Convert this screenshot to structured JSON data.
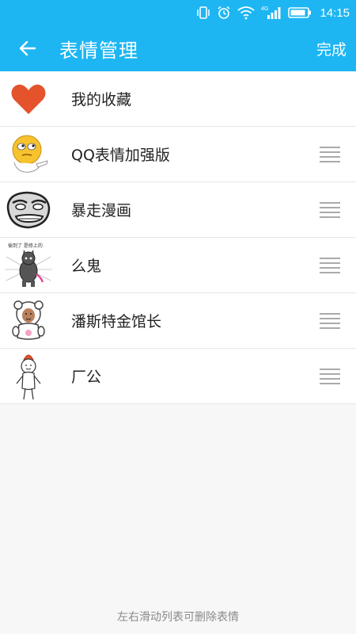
{
  "status_bar": {
    "time": "14:15",
    "network": "4G"
  },
  "header": {
    "title": "表情管理",
    "done_label": "完成"
  },
  "items": [
    {
      "label": "我的收藏",
      "icon": "heart-icon",
      "draggable": false
    },
    {
      "label": "QQ表情加强版",
      "icon": "qq-emoji-face",
      "draggable": true
    },
    {
      "label": "暴走漫画",
      "icon": "rage-comic-face",
      "draggable": true
    },
    {
      "label": "么鬼",
      "icon": "cat-meme",
      "draggable": true
    },
    {
      "label": "潘斯特金馆长",
      "icon": "panda-meme",
      "draggable": true
    },
    {
      "label": "厂公",
      "icon": "doodle-figure",
      "draggable": true
    }
  ],
  "thumb_caption": "偷到了 是修上的",
  "footer": {
    "hint": "左右滑动列表可删除表情"
  },
  "colors": {
    "accent": "#1db6f3",
    "heart": "#e4532c"
  }
}
